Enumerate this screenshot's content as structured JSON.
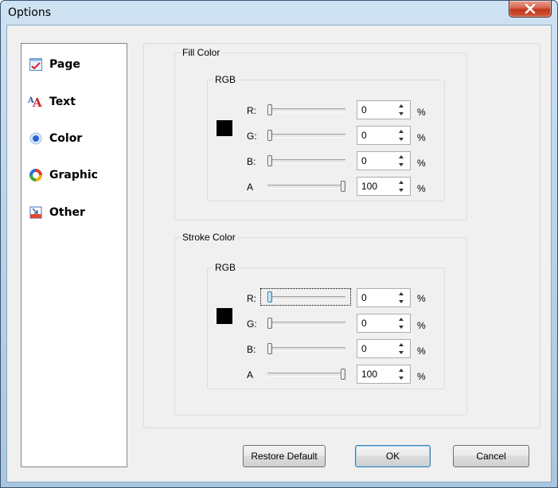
{
  "window": {
    "title": "Options"
  },
  "sidebar": {
    "items": [
      {
        "label": "Page",
        "icon": "page-icon"
      },
      {
        "label": "Text",
        "icon": "text-icon"
      },
      {
        "label": "Color",
        "icon": "color-icon"
      },
      {
        "label": "Graphic",
        "icon": "graphic-icon"
      },
      {
        "label": "Other",
        "icon": "other-icon"
      }
    ]
  },
  "fill": {
    "legend": "Fill Color",
    "rgb_legend": "RGB",
    "swatch_color": "#000000",
    "channels": [
      {
        "label": "R:",
        "value": "0",
        "unit": "%"
      },
      {
        "label": "G:",
        "value": "0",
        "unit": "%"
      },
      {
        "label": "B:",
        "value": "0",
        "unit": "%"
      },
      {
        "label": "A",
        "value": "100",
        "unit": "%"
      }
    ]
  },
  "stroke": {
    "legend": "Stroke Color",
    "rgb_legend": "RGB",
    "swatch_color": "#000000",
    "channels": [
      {
        "label": "R:",
        "value": "0",
        "unit": "%"
      },
      {
        "label": "G:",
        "value": "0",
        "unit": "%"
      },
      {
        "label": "B:",
        "value": "0",
        "unit": "%"
      },
      {
        "label": "A",
        "value": "100",
        "unit": "%"
      }
    ]
  },
  "buttons": {
    "restore_label": "Restore Default",
    "ok_label": "OK",
    "cancel_label": "Cancel"
  },
  "colors": {
    "close_button": "#c1361a",
    "focus_accent": "#3c7fb1"
  }
}
